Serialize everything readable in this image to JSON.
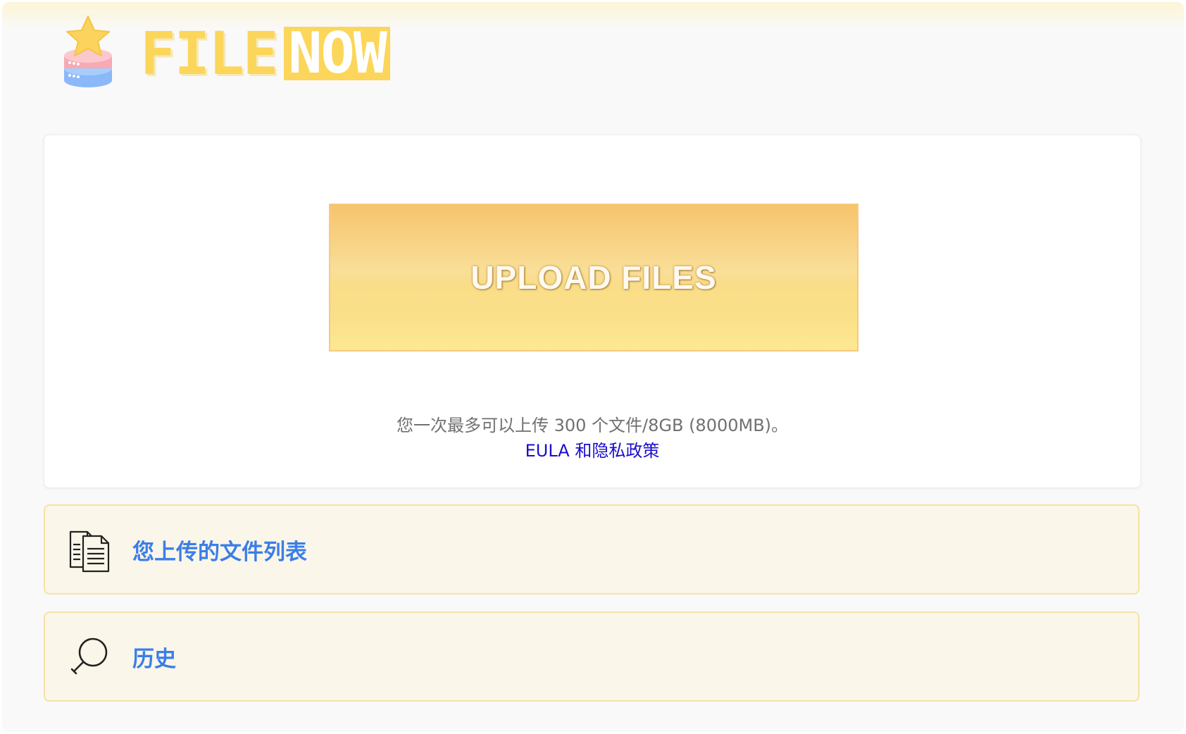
{
  "header": {
    "logo_part1": "FILE",
    "logo_part2": "NOW"
  },
  "upload": {
    "button_label": "UPLOAD FILES",
    "limit_text": "您一次最多可以上传 300 个文件/8GB (8000MB)。",
    "eula_link": "EULA 和隐私政策"
  },
  "options": {
    "files_list_label": "您上传的文件列表",
    "history_label": "历史"
  },
  "colors": {
    "brand_yellow": "#fcd65a",
    "link_blue": "#3b7ee8",
    "eula_blue": "#1a0dcc",
    "row_background": "#faf6e9"
  }
}
